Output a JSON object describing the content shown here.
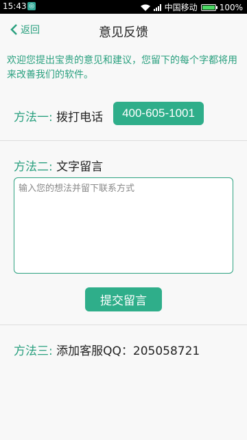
{
  "status_bar": {
    "time": "15:43",
    "carrier": "中国移动",
    "battery": "100%",
    "battery_level": 1.0
  },
  "nav": {
    "back_label": "返回",
    "title": "意见反馈"
  },
  "welcome_text": "欢迎您提出宝贵的意见和建议，您留下的每个字都将用来改善我们的软件。",
  "method1": {
    "label": "方法一:",
    "text": "拨打电话",
    "phone": "400-605-1001"
  },
  "method2": {
    "label": "方法二:",
    "text": "文字留言",
    "placeholder": "输入您的想法并留下联系方式",
    "submit_label": "提交留言"
  },
  "method3": {
    "label": "方法三:",
    "text": "添加客服QQ：205058721"
  },
  "colors": {
    "accent": "#2fae8a",
    "accent_text": "#2aa07f"
  }
}
